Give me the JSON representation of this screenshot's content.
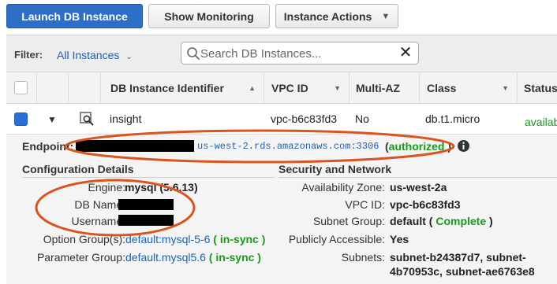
{
  "toolbar": {
    "launch_label": "Launch DB Instance",
    "monitor_label": "Show Monitoring",
    "actions_label": "Instance Actions"
  },
  "filter": {
    "label": "Filter:",
    "selected": "All Instances",
    "search_placeholder": "Search DB Instances..."
  },
  "table": {
    "columns": [
      "DB Instance Identifier",
      "VPC ID",
      "Multi-AZ",
      "Class",
      "Status"
    ],
    "row": {
      "identifier": "insight",
      "vpc_id": "vpc-b6c83fd3",
      "multi_az": "No",
      "class": "db.t1.micro",
      "status": "availab"
    }
  },
  "detail": {
    "endpoint_label": "Endpoint:",
    "endpoint_host": "us-west-2.rds.amazonaws.com:3306",
    "endpoint_open": "(",
    "endpoint_status": "authorized",
    "endpoint_close": ")",
    "config_title": "Configuration Details",
    "security_title": "Security and Network",
    "config": {
      "engine_label": "Engine:",
      "engine_value": "mysql (5.6.13)",
      "dbname_label": "DB Name:",
      "username_label": "Username:",
      "option_group_label": "Option Group(s):",
      "option_group_value": "default:mysql-5-6",
      "option_group_status": "( in-sync )",
      "param_group_label": "Parameter Group:",
      "param_group_value": "default.mysql5.6",
      "param_group_status": "( in-sync )"
    },
    "security": {
      "az_label": "Availability Zone:",
      "az_value": "us-west-2a",
      "vpc_label": "VPC ID:",
      "vpc_value": "vpc-b6c83fd3",
      "subnet_group_label": "Subnet Group:",
      "subnet_group_value": "default",
      "subnet_group_status": "Complete",
      "public_label": "Publicly Accessible:",
      "public_value": "Yes",
      "subnets_label": "Subnets:",
      "subnets_line1": "subnet-b24387d7, subnet-",
      "subnets_line2": "4b70953c, subnet-ae6763e8"
    }
  },
  "colors": {
    "primary_button": "#2e6ec7",
    "link": "#1e62b5",
    "success": "#1a9a1a",
    "annotation": "#d9541e"
  }
}
